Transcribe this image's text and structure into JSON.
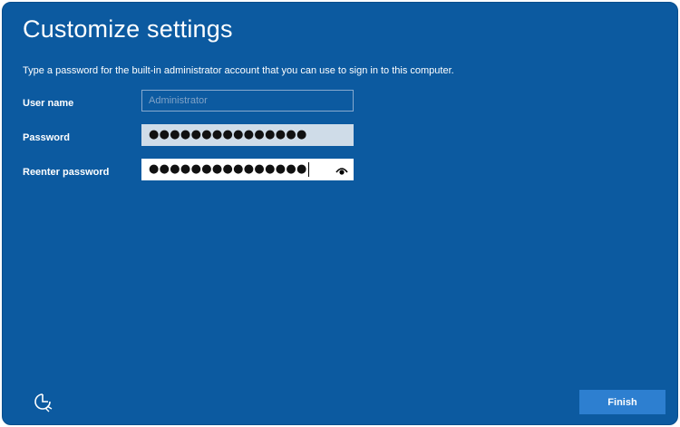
{
  "page": {
    "title": "Customize settings",
    "description": "Type a password for the built-in administrator account that you can use to sign in to this computer."
  },
  "form": {
    "username": {
      "label": "User name",
      "placeholder": "Administrator",
      "value": ""
    },
    "password": {
      "label": "Password",
      "masked_value": "●●●●●●●●●●●●●●●"
    },
    "reenter_password": {
      "label": "Reenter password",
      "masked_value": "●●●●●●●●●●●●●●●"
    }
  },
  "footer": {
    "finish_label": "Finish"
  },
  "icons": {
    "reveal": "eye-icon",
    "accessibility": "ease-of-access-icon"
  },
  "colors": {
    "background": "#0c5aa0",
    "button": "#2d7fd0"
  }
}
